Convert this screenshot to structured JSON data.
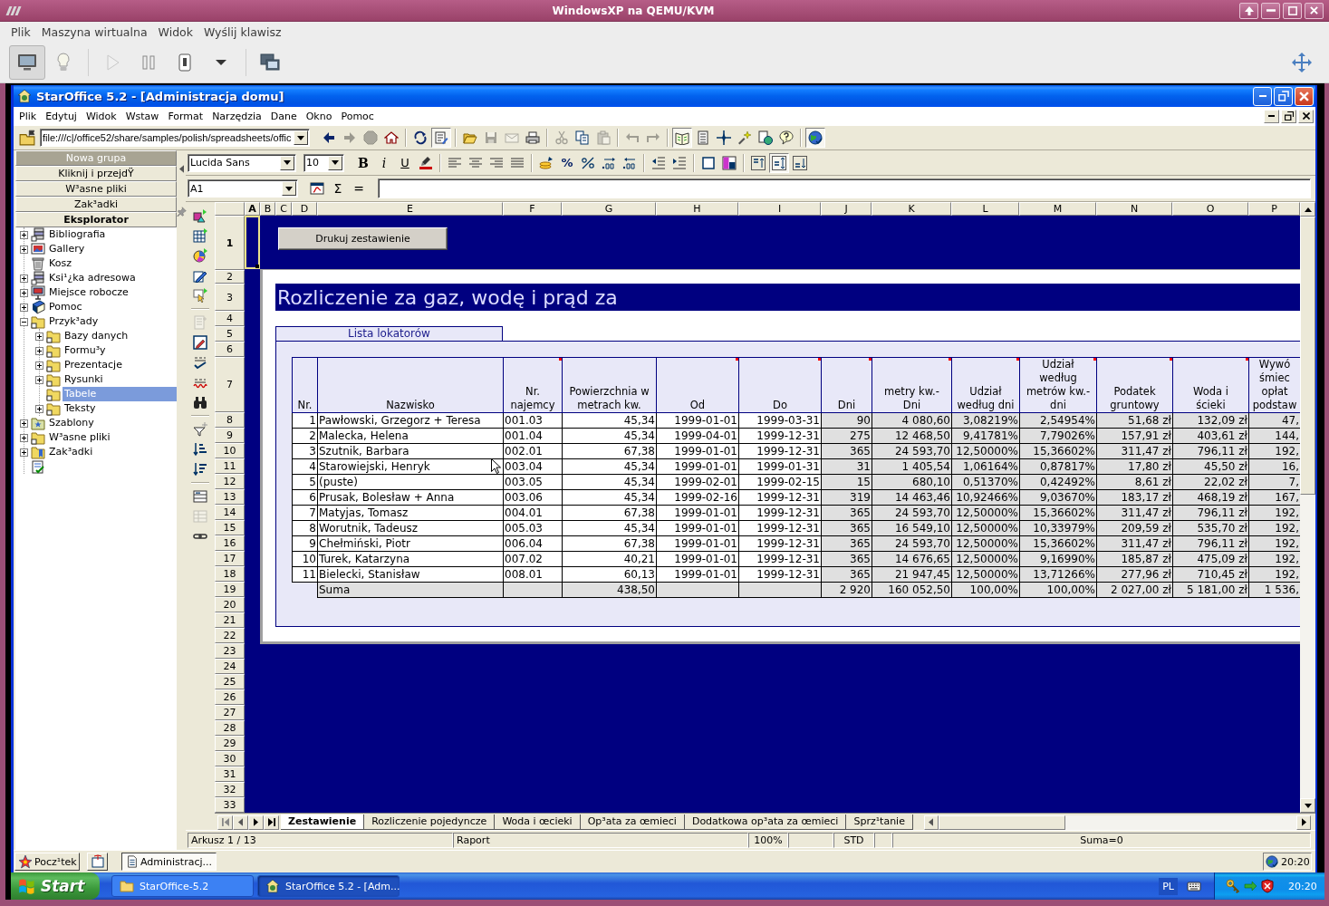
{
  "host_window": {
    "title": "WindowsXP na QEMU/KVM",
    "menu": [
      "Plik",
      "Maszyna wirtualna",
      "Widok",
      "Wyślij klawisz"
    ],
    "toolbar": [
      {
        "pressed": true,
        "disabled": false
      },
      {
        "pressed": false,
        "disabled": false
      },
      {
        "pressed": false,
        "disabled": true
      },
      {
        "pressed": false,
        "disabled": false
      },
      {
        "pressed": false,
        "disabled": false
      },
      {
        "pressed": false,
        "disabled": false
      },
      {
        "pressed": false,
        "disabled": false
      }
    ]
  },
  "app_window": {
    "title": "StarOffice 5.2 - [Administracja domu]",
    "menu": [
      "Plik",
      "Edytuj",
      "Widok",
      "Wstaw",
      "Format",
      "Narzędzia",
      "Dane",
      "Okno",
      "Pomoc"
    ]
  },
  "function_bar": {
    "url": "file:///c|/office52/share/samples/polish/spreadsheets/offic",
    "buttons": [
      {
        "pressed": false,
        "disabled": false
      },
      {
        "pressed": false,
        "disabled": true
      },
      {
        "pressed": false,
        "disabled": true
      },
      {
        "pressed": false,
        "disabled": false
      },
      {
        "pressed": false,
        "disabled": false
      },
      {
        "pressed": true,
        "disabled": false
      },
      {
        "pressed": false,
        "disabled": false
      },
      {
        "pressed": false,
        "disabled": true
      },
      {
        "pressed": false,
        "disabled": true
      },
      {
        "pressed": false,
        "disabled": false
      },
      {
        "pressed": false,
        "disabled": true
      },
      {
        "pressed": false,
        "disabled": false
      },
      {
        "pressed": false,
        "disabled": true
      },
      {
        "pressed": false,
        "disabled": true
      },
      {
        "pressed": false,
        "disabled": true
      },
      {
        "pressed": true,
        "disabled": false
      },
      {
        "pressed": false,
        "disabled": false
      },
      {
        "pressed": false,
        "disabled": false
      },
      {
        "pressed": false,
        "disabled": false
      },
      {
        "pressed": false,
        "disabled": false
      },
      {
        "pressed": false,
        "disabled": false
      },
      {
        "pressed": true,
        "disabled": false
      }
    ]
  },
  "object_bar": {
    "font": "Lucida Sans",
    "size": "10",
    "buttons": [
      {
        "kind": "glyph",
        "label": "B",
        "pressed": false
      },
      {
        "kind": "glyph",
        "label": "i",
        "pressed": false
      },
      {
        "kind": "glyph",
        "label": "U",
        "pressed": false
      },
      {
        "kind": "icon",
        "pressed": false
      },
      {
        "kind": "icon",
        "pressed": false
      },
      {
        "kind": "icon",
        "pressed": false
      },
      {
        "kind": "icon",
        "pressed": false
      },
      {
        "kind": "icon",
        "pressed": false
      },
      {
        "kind": "icon",
        "pressed": false
      },
      {
        "kind": "glyph",
        "label": "%",
        "pressed": false
      },
      {
        "kind": "icon",
        "pressed": false
      },
      {
        "kind": "icon",
        "pressed": false
      },
      {
        "kind": "icon",
        "pressed": false
      },
      {
        "kind": "icon",
        "pressed": false
      },
      {
        "kind": "icon",
        "pressed": false
      },
      {
        "kind": "icon",
        "pressed": false
      },
      {
        "kind": "icon",
        "pressed": false
      },
      {
        "kind": "icon",
        "pressed": false
      },
      {
        "kind": "icon",
        "pressed": true
      },
      {
        "kind": "icon",
        "pressed": false
      }
    ]
  },
  "formula_bar": {
    "cell": "A1",
    "buttons": [
      {
        "kind": "icon"
      },
      {
        "kind": "glyph",
        "label": "Σ"
      },
      {
        "kind": "glyph",
        "label": "="
      }
    ]
  },
  "explorer": {
    "groups": [
      {
        "label": "Nowa grupa",
        "selected": false,
        "highlighted": true
      },
      {
        "label": "Kliknij i przejdŸ",
        "selected": false,
        "highlighted": false
      },
      {
        "label": "W³asne pliki",
        "selected": false,
        "highlighted": false
      },
      {
        "label": "Zak³adki",
        "selected": false,
        "highlighted": false
      },
      {
        "label": "Eksplorator",
        "selected": true,
        "highlighted": false
      }
    ],
    "tree": [
      {
        "label": "Bibliografia",
        "kind": "database",
        "expanded": false,
        "selected": false
      },
      {
        "label": "Gallery",
        "kind": "gallery",
        "expanded": false,
        "selected": false
      },
      {
        "label": "Kosz",
        "kind": "trash",
        "selected": false
      },
      {
        "label": "Ksi¹¿ka adresowa",
        "kind": "database",
        "expanded": false,
        "selected": false
      },
      {
        "label": "Miejsce robocze",
        "kind": "workspace",
        "expanded": false,
        "selected": false
      },
      {
        "label": "Pomoc",
        "kind": "help",
        "expanded": false,
        "selected": false
      },
      {
        "label": "Przyk³ady",
        "kind": "folder",
        "expanded": true,
        "selected": false,
        "children": [
          {
            "label": "Bazy danych",
            "kind": "folder",
            "expanded": false,
            "selected": false
          },
          {
            "label": "Formu³y",
            "kind": "folder",
            "expanded": false,
            "selected": false
          },
          {
            "label": "Prezentacje",
            "kind": "folder",
            "expanded": false,
            "selected": false
          },
          {
            "label": "Rysunki",
            "kind": "folder",
            "expanded": false,
            "selected": false
          },
          {
            "label": "Tabele",
            "kind": "folder",
            "selected": true
          },
          {
            "label": "Teksty",
            "kind": "folder",
            "expanded": false,
            "selected": false
          }
        ]
      },
      {
        "label": "Szablony",
        "kind": "template",
        "expanded": false,
        "selected": false
      },
      {
        "label": "W³asne pliki",
        "kind": "folder",
        "expanded": false,
        "selected": false
      },
      {
        "label": "Zak³adki",
        "kind": "bookmarks",
        "expanded": false,
        "selected": false
      },
      {
        "kind": "task",
        "selected": false
      }
    ]
  },
  "sheet_toolbar": [
    {
      "disabled": false
    },
    {
      "disabled": false
    },
    {
      "disabled": false
    },
    {
      "disabled": false
    },
    {
      "disabled": false
    },
    {
      "disabled": true
    },
    {
      "disabled": false
    },
    {
      "disabled": false
    },
    {
      "disabled": false
    },
    {
      "disabled": false
    },
    {
      "disabled": false
    },
    {
      "disabled": false
    },
    {
      "disabled": false
    },
    {
      "disabled": false
    },
    {
      "disabled": true
    },
    {
      "disabled": false
    }
  ],
  "sheet": {
    "columns": [
      {
        "label": "A",
        "selected": true
      },
      {
        "label": "B",
        "selected": false
      },
      {
        "label": "C",
        "selected": false
      },
      {
        "label": "D",
        "selected": false
      },
      {
        "label": "E",
        "selected": false
      },
      {
        "label": "F",
        "selected": false
      },
      {
        "label": "G",
        "selected": false
      },
      {
        "label": "H",
        "selected": false
      },
      {
        "label": "I",
        "selected": false
      },
      {
        "label": "J",
        "selected": false
      },
      {
        "label": "K",
        "selected": false
      },
      {
        "label": "L",
        "selected": false
      },
      {
        "label": "M",
        "selected": false
      },
      {
        "label": "N",
        "selected": false
      },
      {
        "label": "O",
        "selected": false
      },
      {
        "label": "P",
        "selected": false
      }
    ],
    "rows": [
      {
        "label": "1",
        "selected": true
      },
      {
        "label": "2",
        "selected": false
      },
      {
        "label": "3",
        "selected": false
      },
      {
        "label": "4",
        "selected": false
      },
      {
        "label": "5",
        "selected": false
      },
      {
        "label": "6",
        "selected": false
      },
      {
        "label": "7",
        "selected": false
      },
      {
        "label": "8",
        "selected": false
      },
      {
        "label": "9",
        "selected": false
      },
      {
        "label": "10",
        "selected": false
      },
      {
        "label": "11",
        "selected": false
      },
      {
        "label": "12",
        "selected": false
      },
      {
        "label": "13",
        "selected": false
      },
      {
        "label": "14",
        "selected": false
      },
      {
        "label": "15",
        "selected": false
      },
      {
        "label": "16",
        "selected": false
      },
      {
        "label": "17",
        "selected": false
      },
      {
        "label": "18",
        "selected": false
      },
      {
        "label": "19",
        "selected": false
      },
      {
        "label": "20",
        "selected": false
      },
      {
        "label": "21",
        "selected": false
      },
      {
        "label": "22",
        "selected": false
      },
      {
        "label": "23",
        "selected": false
      },
      {
        "label": "24",
        "selected": false
      },
      {
        "label": "25",
        "selected": false
      },
      {
        "label": "26",
        "selected": false
      },
      {
        "label": "27",
        "selected": false
      },
      {
        "label": "28",
        "selected": false
      },
      {
        "label": "29",
        "selected": false
      },
      {
        "label": "30",
        "selected": false
      },
      {
        "label": "31",
        "selected": false
      },
      {
        "label": "32",
        "selected": false
      },
      {
        "label": "33",
        "selected": false
      }
    ]
  },
  "report": {
    "button": "Drukuj zestawienie",
    "title": "Rozliczenie za gaz, wodę i prąd za",
    "section": "Lista lokatorów",
    "table": {
      "columns": [
        {
          "label": "Nr.",
          "comment": false,
          "shaded": false
        },
        {
          "label": "Nazwisko",
          "comment": false,
          "shaded": false
        },
        {
          "label": "Nr.\nnajemcy",
          "comment": true,
          "shaded": false
        },
        {
          "label": "Powierzchnia w\nmetrach kw.",
          "comment": false,
          "shaded": false
        },
        {
          "label": "Od",
          "comment": true,
          "shaded": false
        },
        {
          "label": "Do",
          "comment": true,
          "shaded": false
        },
        {
          "label": "Dni",
          "comment": true,
          "shaded": true
        },
        {
          "label": "metry kw.-\nDni",
          "comment": true,
          "shaded": true
        },
        {
          "label": "Udział\nwedług dni",
          "comment": true,
          "shaded": true
        },
        {
          "label": "Udział\nwedług\nmetrów kw.-\ndni",
          "comment": true,
          "shaded": true
        },
        {
          "label": "Podatek\ngruntowy",
          "comment": true,
          "shaded": true
        },
        {
          "label": "Woda i\nścieki",
          "comment": true,
          "shaded": true
        },
        {
          "label": "Wywó\nśmiec\nopłat\npodstaw",
          "comment": false,
          "shaded": true
        }
      ],
      "rows": [
        [
          "1",
          "Pawłowski, Grzegorz + Teresa",
          "001.03",
          "45,34",
          "1999-01-01",
          "1999-03-31",
          "90",
          "4 080,60",
          "3,08219%",
          "2,54954%",
          "51,68 zł",
          "132,09 zł",
          "47,"
        ],
        [
          "2",
          "Malecka, Helena",
          "001.04",
          "45,34",
          "1999-04-01",
          "1999-12-31",
          "275",
          "12 468,50",
          "9,41781%",
          "7,79026%",
          "157,91 zł",
          "403,61 zł",
          "144,"
        ],
        [
          "3",
          "Szutnik, Barbara",
          "002.01",
          "67,38",
          "1999-01-01",
          "1999-12-31",
          "365",
          "24 593,70",
          "12,50000%",
          "15,36602%",
          "311,47 zł",
          "796,11 zł",
          "192,"
        ],
        [
          "4",
          "Starowiejski, Henryk",
          "003.04",
          "45,34",
          "1999-01-01",
          "1999-01-31",
          "31",
          "1 405,54",
          "1,06164%",
          "0,87817%",
          "17,80 zł",
          "45,50 zł",
          "16,"
        ],
        [
          "5",
          "(puste)",
          "003.05",
          "45,34",
          "1999-02-01",
          "1999-02-15",
          "15",
          "680,10",
          "0,51370%",
          "0,42492%",
          "8,61 zł",
          "22,02 zł",
          "7,"
        ],
        [
          "6",
          "Prusak, Bolesław + Anna",
          "003.06",
          "45,34",
          "1999-02-16",
          "1999-12-31",
          "319",
          "14 463,46",
          "10,92466%",
          "9,03670%",
          "183,17 zł",
          "468,19 zł",
          "167,"
        ],
        [
          "7",
          "Matyjas, Tomasz",
          "004.01",
          "67,38",
          "1999-01-01",
          "1999-12-31",
          "365",
          "24 593,70",
          "12,50000%",
          "15,36602%",
          "311,47 zł",
          "796,11 zł",
          "192,"
        ],
        [
          "8",
          "Worutnik, Tadeusz",
          "005.03",
          "45,34",
          "1999-01-01",
          "1999-12-31",
          "365",
          "16 549,10",
          "12,50000%",
          "10,33979%",
          "209,59 zł",
          "535,70 zł",
          "192,"
        ],
        [
          "9",
          "Chełmiński, Piotr",
          "006.04",
          "67,38",
          "1999-01-01",
          "1999-12-31",
          "365",
          "24 593,70",
          "12,50000%",
          "15,36602%",
          "311,47 zł",
          "796,11 zł",
          "192,"
        ],
        [
          "10",
          "Turek, Katarzyna",
          "007.02",
          "40,21",
          "1999-01-01",
          "1999-12-31",
          "365",
          "14 676,65",
          "12,50000%",
          "9,16990%",
          "185,87 zł",
          "475,09 zł",
          "192,"
        ],
        [
          "11",
          "Bielecki, Stanisław",
          "008.01",
          "60,13",
          "1999-01-01",
          "1999-12-31",
          "365",
          "21 947,45",
          "12,50000%",
          "13,71266%",
          "277,96 zł",
          "710,45 zł",
          "192,"
        ]
      ],
      "total": {
        "label": "Suma",
        "area": "438,50",
        "days": "2 920",
        "area_days": "160 052,50",
        "share_by_days": "100,00%",
        "share_by_area": "100,00%",
        "land_tax": "2 027,00 zł",
        "water": "5 181,00 zł",
        "column_13": "1 536,"
      }
    }
  },
  "sheet_tabs": [
    {
      "label": "Zestawienie",
      "selected": true
    },
    {
      "label": "Rozliczenie pojedyncze",
      "selected": false
    },
    {
      "label": "Woda i œcieki",
      "selected": false
    },
    {
      "label": "Op³ata za œmieci",
      "selected": false
    },
    {
      "label": "Dodatkowa op³ata za œmieci",
      "selected": false
    },
    {
      "label": "Sprz¹tanie",
      "selected": false
    }
  ],
  "status_bar": {
    "sheet": "Arkusz 1 / 13",
    "style": "Raport",
    "zoom": "100%",
    "mode": "STD",
    "sum": "Suma=0"
  },
  "office_taskbar": {
    "start": "Pocz¹tek",
    "tasks": [
      {
        "label": "Administracj...",
        "selected": true
      }
    ],
    "clock": "20:20"
  },
  "xp_taskbar": {
    "start": "Start",
    "tasks": [
      {
        "label": "StarOffice-5.2",
        "selected": false
      },
      {
        "label": "StarOffice 5.2 - [Adm...",
        "selected": true
      }
    ],
    "language": "PL",
    "clock": "20:20"
  }
}
